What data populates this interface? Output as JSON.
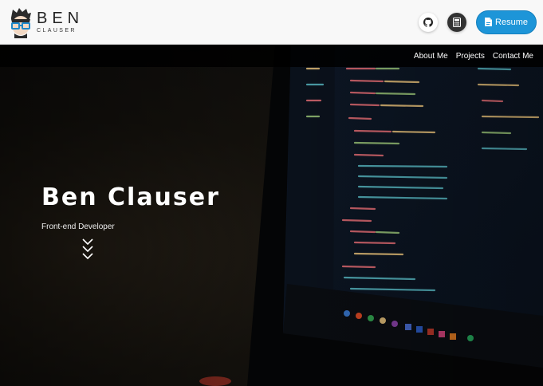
{
  "logo": {
    "big": "BEN",
    "small": "CLAUSER"
  },
  "header": {
    "github_icon": "github-icon",
    "calculator_icon": "calculator-icon",
    "resume_label": "Resume",
    "resume_icon": "file-pdf-icon"
  },
  "nav": {
    "items": [
      {
        "label": "About Me"
      },
      {
        "label": "Projects"
      },
      {
        "label": "Contact Me"
      }
    ]
  },
  "hero": {
    "name": "Ben Clauser",
    "role": "Front-end Developer",
    "scroll_icon": "chevron-triple-down-icon"
  },
  "colors": {
    "accent": "#1d95d8",
    "header_bg": "#f8f8f8",
    "nav_bg": "#000000"
  }
}
